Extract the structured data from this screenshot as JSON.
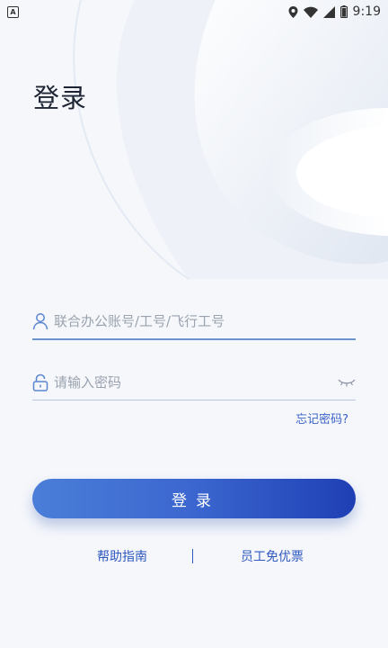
{
  "status_bar": {
    "sim_label": "A",
    "time": "9:19"
  },
  "page": {
    "title": "登录"
  },
  "form": {
    "account_placeholder": "联合办公账号/工号/飞行工号",
    "password_placeholder": "请输入密码",
    "forgot_label": "忘记密码?",
    "login_label": "登录"
  },
  "links": {
    "help": "帮助指南",
    "staff_ticket": "员工免优票"
  },
  "colors": {
    "accent": "#3a63c7",
    "button_start": "#4a7ed8",
    "button_end": "#1e3fb4"
  }
}
